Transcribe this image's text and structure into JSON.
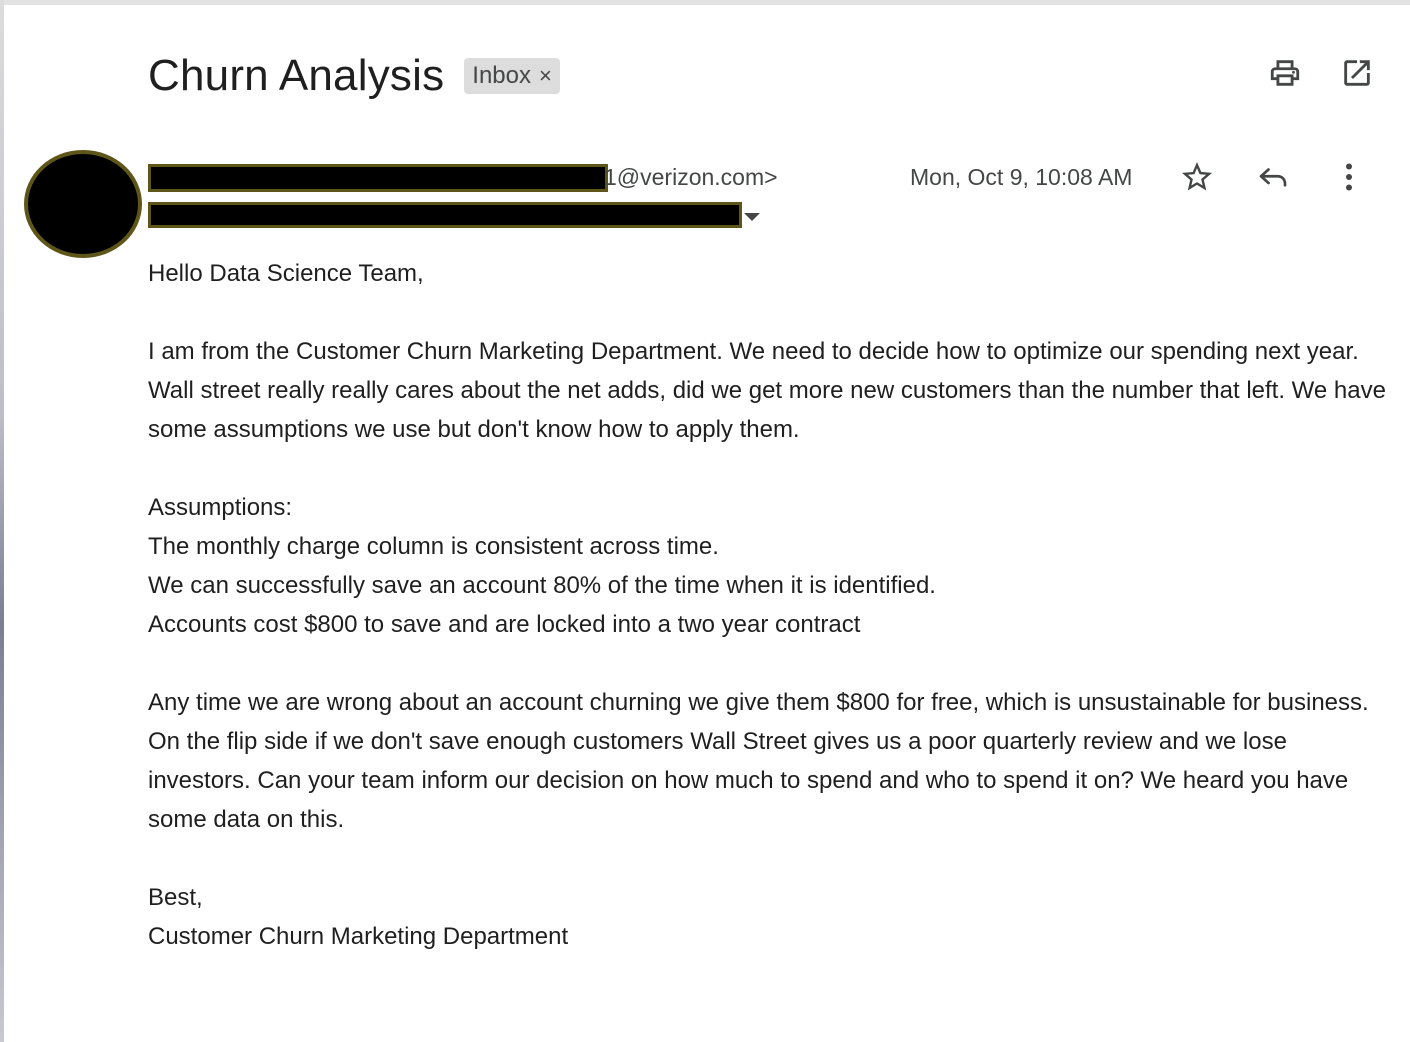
{
  "email": {
    "subject": "Churn Analysis",
    "label": "Inbox",
    "label_remove": "×",
    "sender_email_suffix": "1@verizon.com>",
    "date": "Mon, Oct 9, 10:08 AM",
    "greeting": "Hello Data Science Team,",
    "paragraph1": "I am from the Customer Churn Marketing Department. We need to decide how to optimize our spending next year. Wall street really really cares about the net adds, did we get more new customers than the number that left. We have some assumptions we use but don't know how to apply them.",
    "assumptions_heading": "Assumptions:",
    "assumptions": [
      "The monthly charge column is consistent across time.",
      "We can successfully save an account 80% of the time when it is identified.",
      "Accounts cost $800 to save and are locked into a two year contract"
    ],
    "paragraph2": "Any time we are wrong about an account churning we give them $800 for free, which is unsustainable for business. On the flip side if we don't save enough customers Wall Street gives us a poor quarterly review and we lose investors. Can your team inform our decision on how much to spend and who to spend it on? We heard you have some data on this.",
    "signoff": "Best,",
    "signature": "Customer Churn Marketing Department"
  },
  "icons": {
    "print": "print-icon",
    "open_new_window": "open-in-new-window-icon",
    "star": "star-icon",
    "reply": "reply-icon",
    "more": "more-vertical-icon"
  },
  "colors": {
    "redaction_border": "#5e5618",
    "label_bg": "#dddddd",
    "secondary_text": "#444746"
  }
}
